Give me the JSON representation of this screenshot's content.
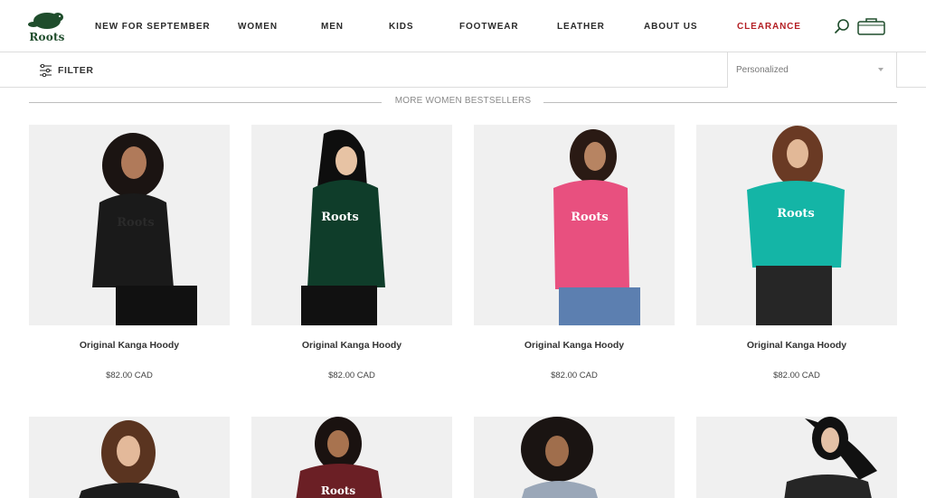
{
  "header": {
    "logo_text": "Roots",
    "nav": [
      {
        "label": "NEW FOR SEPTEMBER"
      },
      {
        "label": "WOMEN"
      },
      {
        "label": "MEN"
      },
      {
        "label": "KIDS"
      },
      {
        "label": "FOOTWEAR"
      },
      {
        "label": "LEATHER"
      },
      {
        "label": "ABOUT US"
      },
      {
        "label": "CLEARANCE",
        "color": "#b41f24"
      }
    ],
    "icons": [
      "search-icon",
      "bag-icon"
    ]
  },
  "filterbar": {
    "filter_label": "FILTER",
    "sort_value": "Personalized"
  },
  "section": {
    "title": "MORE WOMEN BESTSELLERS"
  },
  "products": [
    {
      "name": "Original Kanga Hoody",
      "price": "$82.00 CAD",
      "color": "#1a1a1a"
    },
    {
      "name": "Original Kanga Hoody",
      "price": "$82.00 CAD",
      "color": "#0f3d2a"
    },
    {
      "name": "Original Kanga Hoody",
      "price": "$82.00 CAD",
      "color": "#e8507f"
    },
    {
      "name": "Original Kanga Hoody",
      "price": "$82.00 CAD",
      "color": "#14b5a6"
    }
  ],
  "products_row2": [
    {
      "color": "#1c1c1c"
    },
    {
      "color": "#6b1f25"
    },
    {
      "color": "#9aa7b8"
    },
    {
      "color": "#262626"
    }
  ]
}
